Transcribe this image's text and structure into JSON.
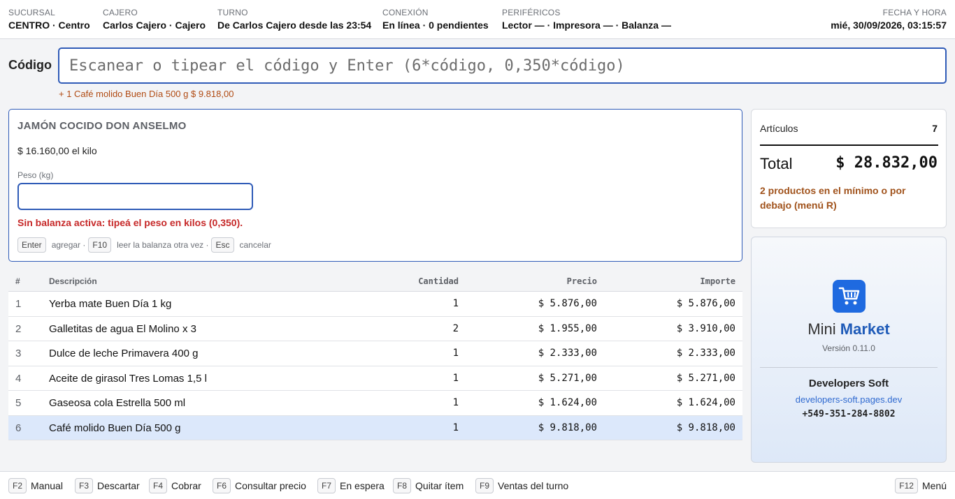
{
  "header": {
    "sucursal": {
      "label": "SUCURSAL",
      "value": "CENTRO · Centro"
    },
    "cajero": {
      "label": "CAJERO",
      "value": "Carlos Cajero · Cajero"
    },
    "turno": {
      "label": "TURNO",
      "value": "De Carlos Cajero desde las 23:54"
    },
    "conexion": {
      "label": "CONEXIÓN",
      "value": "En línea · 0 pendientes"
    },
    "perifericos": {
      "label": "PERIFÉRICOS",
      "value": "Lector — · Impresora — · Balanza —"
    },
    "fecha": {
      "label": "FECHA Y HORA",
      "value": "mié, 30/09/2026, 03:15:57"
    }
  },
  "code": {
    "label": "Código",
    "placeholder": "Escanear o tipear el código y Enter (6*código, 0,350*código)",
    "value": "",
    "last_added": "+ 1 Café molido Buen Día 500 g $ 9.818,00"
  },
  "weight_panel": {
    "product": "JAMÓN COCIDO DON ANSELMO",
    "price": "$ 16.160,00 el kilo",
    "peso_label": "Peso (kg)",
    "peso_value": "",
    "error": "Sin balanza activa: tipeá el peso en kilos (0,350).",
    "hints": [
      {
        "key": "Enter",
        "text": "agregar ·"
      },
      {
        "key": "F10",
        "text": "leer la balanza otra vez ·"
      },
      {
        "key": "Esc",
        "text": "cancelar"
      }
    ]
  },
  "table": {
    "headers": {
      "num": "#",
      "desc": "Descripción",
      "qty": "Cantidad",
      "price": "Precio",
      "imp": "Importe"
    },
    "rows": [
      {
        "num": "1",
        "desc": "Yerba mate Buen Día 1 kg",
        "qty": "1",
        "price": "$ 5.876,00",
        "imp": "$ 5.876,00"
      },
      {
        "num": "2",
        "desc": "Galletitas de agua El Molino x 3",
        "qty": "2",
        "price": "$ 1.955,00",
        "imp": "$ 3.910,00"
      },
      {
        "num": "3",
        "desc": "Dulce de leche Primavera 400 g",
        "qty": "1",
        "price": "$ 2.333,00",
        "imp": "$ 2.333,00"
      },
      {
        "num": "4",
        "desc": "Aceite de girasol Tres Lomas 1,5 l",
        "qty": "1",
        "price": "$ 5.271,00",
        "imp": "$ 5.271,00"
      },
      {
        "num": "5",
        "desc": "Gaseosa cola Estrella 500 ml",
        "qty": "1",
        "price": "$ 1.624,00",
        "imp": "$ 1.624,00"
      },
      {
        "num": "6",
        "desc": "Café molido Buen Día 500 g",
        "qty": "1",
        "price": "$ 9.818,00",
        "imp": "$ 9.818,00"
      }
    ],
    "selected_row": 6
  },
  "summary": {
    "articulos_label": "Artículos",
    "articulos_value": "7",
    "total_label": "Total",
    "total_value": "$ 28.832,00",
    "warning": "2 productos en el mínimo o por debajo (menú R)"
  },
  "brand": {
    "name_plain": "Mini ",
    "name_bold": "Market",
    "version": "Versión 0.11.0",
    "company": "Developers Soft",
    "url": "developers-soft.pages.dev",
    "phone": "+549-351-284-8802",
    "logo_icon": "shopping-cart-icon",
    "accent": "#1f6ae0"
  },
  "footer": {
    "keys": [
      {
        "key": "F2",
        "label": "Manual"
      },
      {
        "key": "F3",
        "label": "Descartar"
      },
      {
        "key": "F4",
        "label": "Cobrar"
      },
      {
        "key": "F6",
        "label": "Consultar precio"
      },
      {
        "key": "F7",
        "label": "En espera"
      },
      {
        "key": "F8",
        "label": "Quitar ítem"
      },
      {
        "key": "F9",
        "label": "Ventas del turno"
      }
    ],
    "menu": {
      "key": "F12",
      "label": "Menú"
    }
  }
}
